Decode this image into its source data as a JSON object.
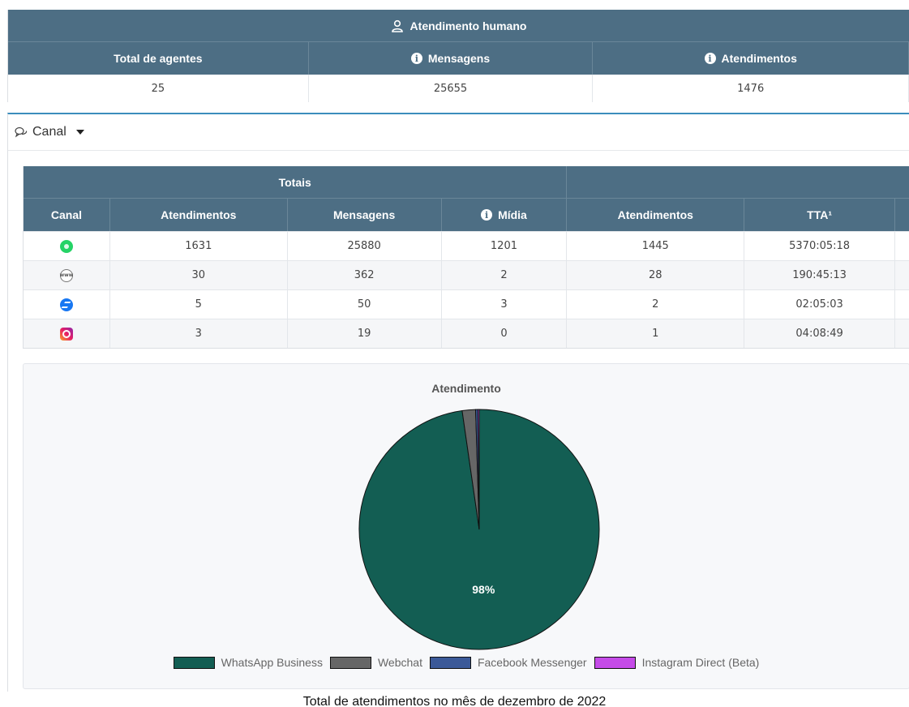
{
  "human": {
    "title": "Atendimento humano",
    "headers": [
      "Total de agentes",
      "Mensagens",
      "Atendimentos"
    ],
    "values": [
      "25",
      "25655",
      "1476"
    ]
  },
  "canal": {
    "label": "Canal",
    "groups": [
      "Totais",
      ""
    ],
    "headers": [
      "Canal",
      "Atendimentos",
      "Mensagens",
      "Mídia",
      "Atendimentos",
      "TTA¹"
    ],
    "rows": [
      {
        "icon": "whatsapp-icon",
        "cells": [
          "1631",
          "25880",
          "1201",
          "1445",
          "5370:05:18"
        ]
      },
      {
        "icon": "webchat-icon",
        "cells": [
          "30",
          "362",
          "2",
          "28",
          "190:45:13"
        ]
      },
      {
        "icon": "messenger-icon",
        "cells": [
          "5",
          "50",
          "3",
          "2",
          "02:05:03"
        ]
      },
      {
        "icon": "instagram-icon",
        "cells": [
          "3",
          "19",
          "0",
          "1",
          "04:08:49"
        ]
      }
    ]
  },
  "chart_data": {
    "type": "pie",
    "title": "Atendimento",
    "categories": [
      "WhatsApp Business",
      "Webchat",
      "Facebook Messenger",
      "Instagram Direct (Beta)"
    ],
    "values": [
      1631,
      30,
      5,
      3
    ],
    "colors": [
      "#135e53",
      "#666666",
      "#3b5998",
      "#c54be8"
    ],
    "data_labels": [
      "98%"
    ],
    "legend": "bottom"
  },
  "caption": "Total de atendimentos no mês de dezembro de 2022"
}
